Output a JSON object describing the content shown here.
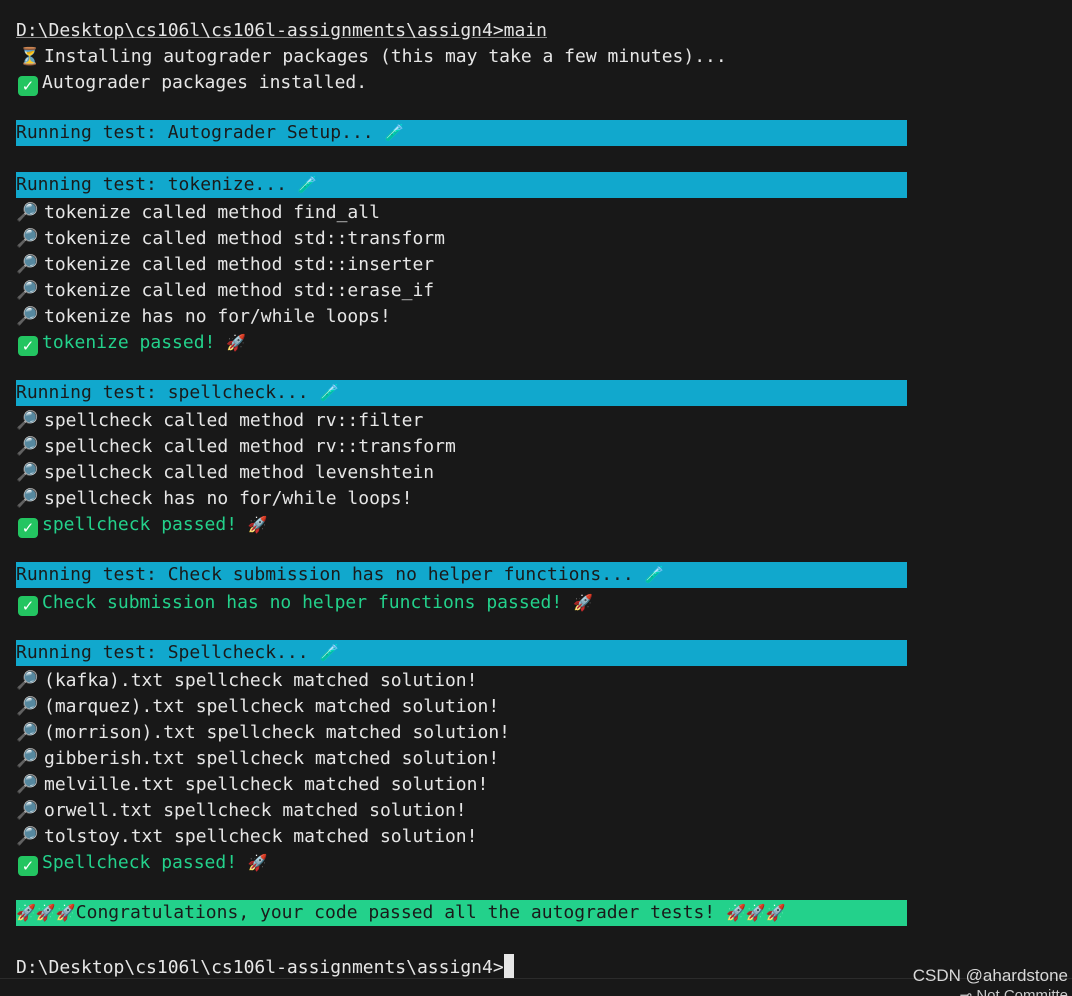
{
  "prompt": {
    "first": "D:\\Desktop\\cs106l\\cs106l-assignments\\assign4>main",
    "last": "D:\\Desktop\\cs106l\\cs106l-assignments\\assign4>"
  },
  "setup": {
    "installing": "Installing autograder packages (this may take a few minutes)...",
    "installed": "Autograder packages installed."
  },
  "tests": {
    "setup_banner": "Running test: Autograder Setup... ",
    "tokenize_banner": "Running test: tokenize... ",
    "tokenize_lines": [
      "tokenize called method find_all",
      "tokenize called method std::transform",
      "tokenize called method std::inserter",
      "tokenize called method std::erase_if",
      "tokenize has no for/while loops!"
    ],
    "tokenize_passed": "tokenize passed! ",
    "spellcheck_banner": "Running test: spellcheck... ",
    "spellcheck_lines": [
      "spellcheck called method rv::filter",
      "spellcheck called method rv::transform",
      "spellcheck called method levenshtein",
      "spellcheck has no for/while loops!"
    ],
    "spellcheck_passed": "spellcheck passed! ",
    "helper_banner": "Running test: Check submission has no helper functions... ",
    "helper_passed": "Check submission has no helper functions passed! ",
    "spellcheck2_banner": "Running test: Spellcheck... ",
    "spellcheck2_lines": [
      "(kafka).txt spellcheck matched solution!",
      "(marquez).txt spellcheck matched solution!",
      "(morrison).txt spellcheck matched solution!",
      "gibberish.txt spellcheck matched solution!",
      "melville.txt spellcheck matched solution!",
      "orwell.txt spellcheck matched solution!",
      "tolstoy.txt spellcheck matched solution!"
    ],
    "spellcheck2_passed": "Spellcheck passed! ",
    "congrats": "Congratulations, your code passed all the autograder tests! "
  },
  "icons": {
    "hourglass": "⏳",
    "check": "✓",
    "magnifier": "🔎",
    "test_tube": "🧪",
    "rocket": "🚀"
  },
  "colors": {
    "banner_running": "#11a8cd",
    "banner_success": "#23d18b",
    "pass_text": "#23d18b",
    "check_box": "#23c561",
    "background": "#181818"
  },
  "watermark": "CSDN @ahardstone",
  "status": "Not Committe"
}
